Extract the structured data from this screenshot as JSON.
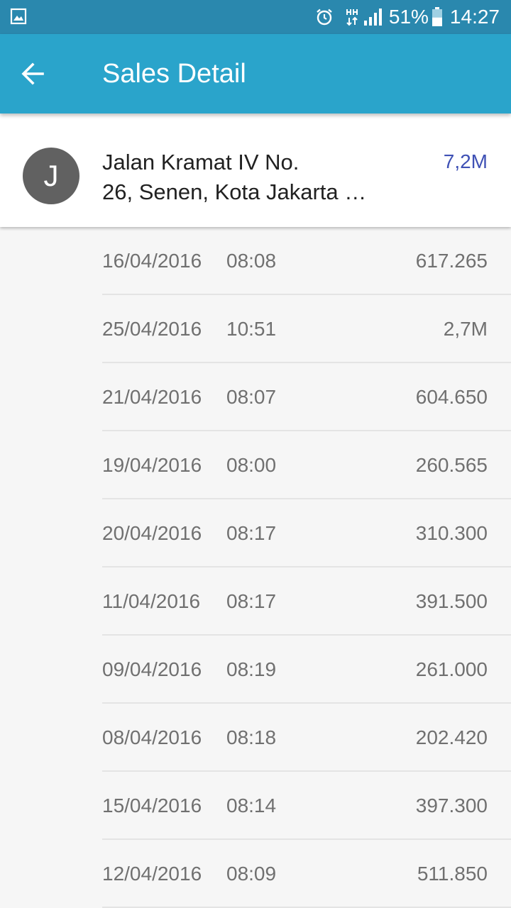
{
  "status_bar": {
    "battery_percent": "51%",
    "battery_level": 0.51,
    "time": "14:27",
    "icons": [
      "gallery-icon",
      "alarm-icon",
      "network-type-icon",
      "signal-icon",
      "battery-icon"
    ]
  },
  "app_bar": {
    "title": "Sales Detail",
    "back_icon": "arrow-left-icon"
  },
  "colors": {
    "status_bar": "#2a88ae",
    "app_bar": "#2aa4cb",
    "avatar": "#616161",
    "total_accent": "#3f51b5"
  },
  "customer": {
    "avatar_letter": "J",
    "address_line1": "Jalan Kramat IV No.",
    "address_line2": "26, Senen, Kota Jakarta …",
    "total": "7,2M"
  },
  "sales": [
    {
      "date": "16/04/2016",
      "time": "08:08",
      "amount": "617.265"
    },
    {
      "date": "25/04/2016",
      "time": "10:51",
      "amount": "2,7M"
    },
    {
      "date": "21/04/2016",
      "time": "08:07",
      "amount": "604.650"
    },
    {
      "date": "19/04/2016",
      "time": "08:00",
      "amount": "260.565"
    },
    {
      "date": "20/04/2016",
      "time": "08:17",
      "amount": "310.300"
    },
    {
      "date": "11/04/2016",
      "time": "08:17",
      "amount": "391.500"
    },
    {
      "date": "09/04/2016",
      "time": "08:19",
      "amount": "261.000"
    },
    {
      "date": "08/04/2016",
      "time": "08:18",
      "amount": "202.420"
    },
    {
      "date": "15/04/2016",
      "time": "08:14",
      "amount": "397.300"
    },
    {
      "date": "12/04/2016",
      "time": "08:09",
      "amount": "511.850"
    }
  ]
}
